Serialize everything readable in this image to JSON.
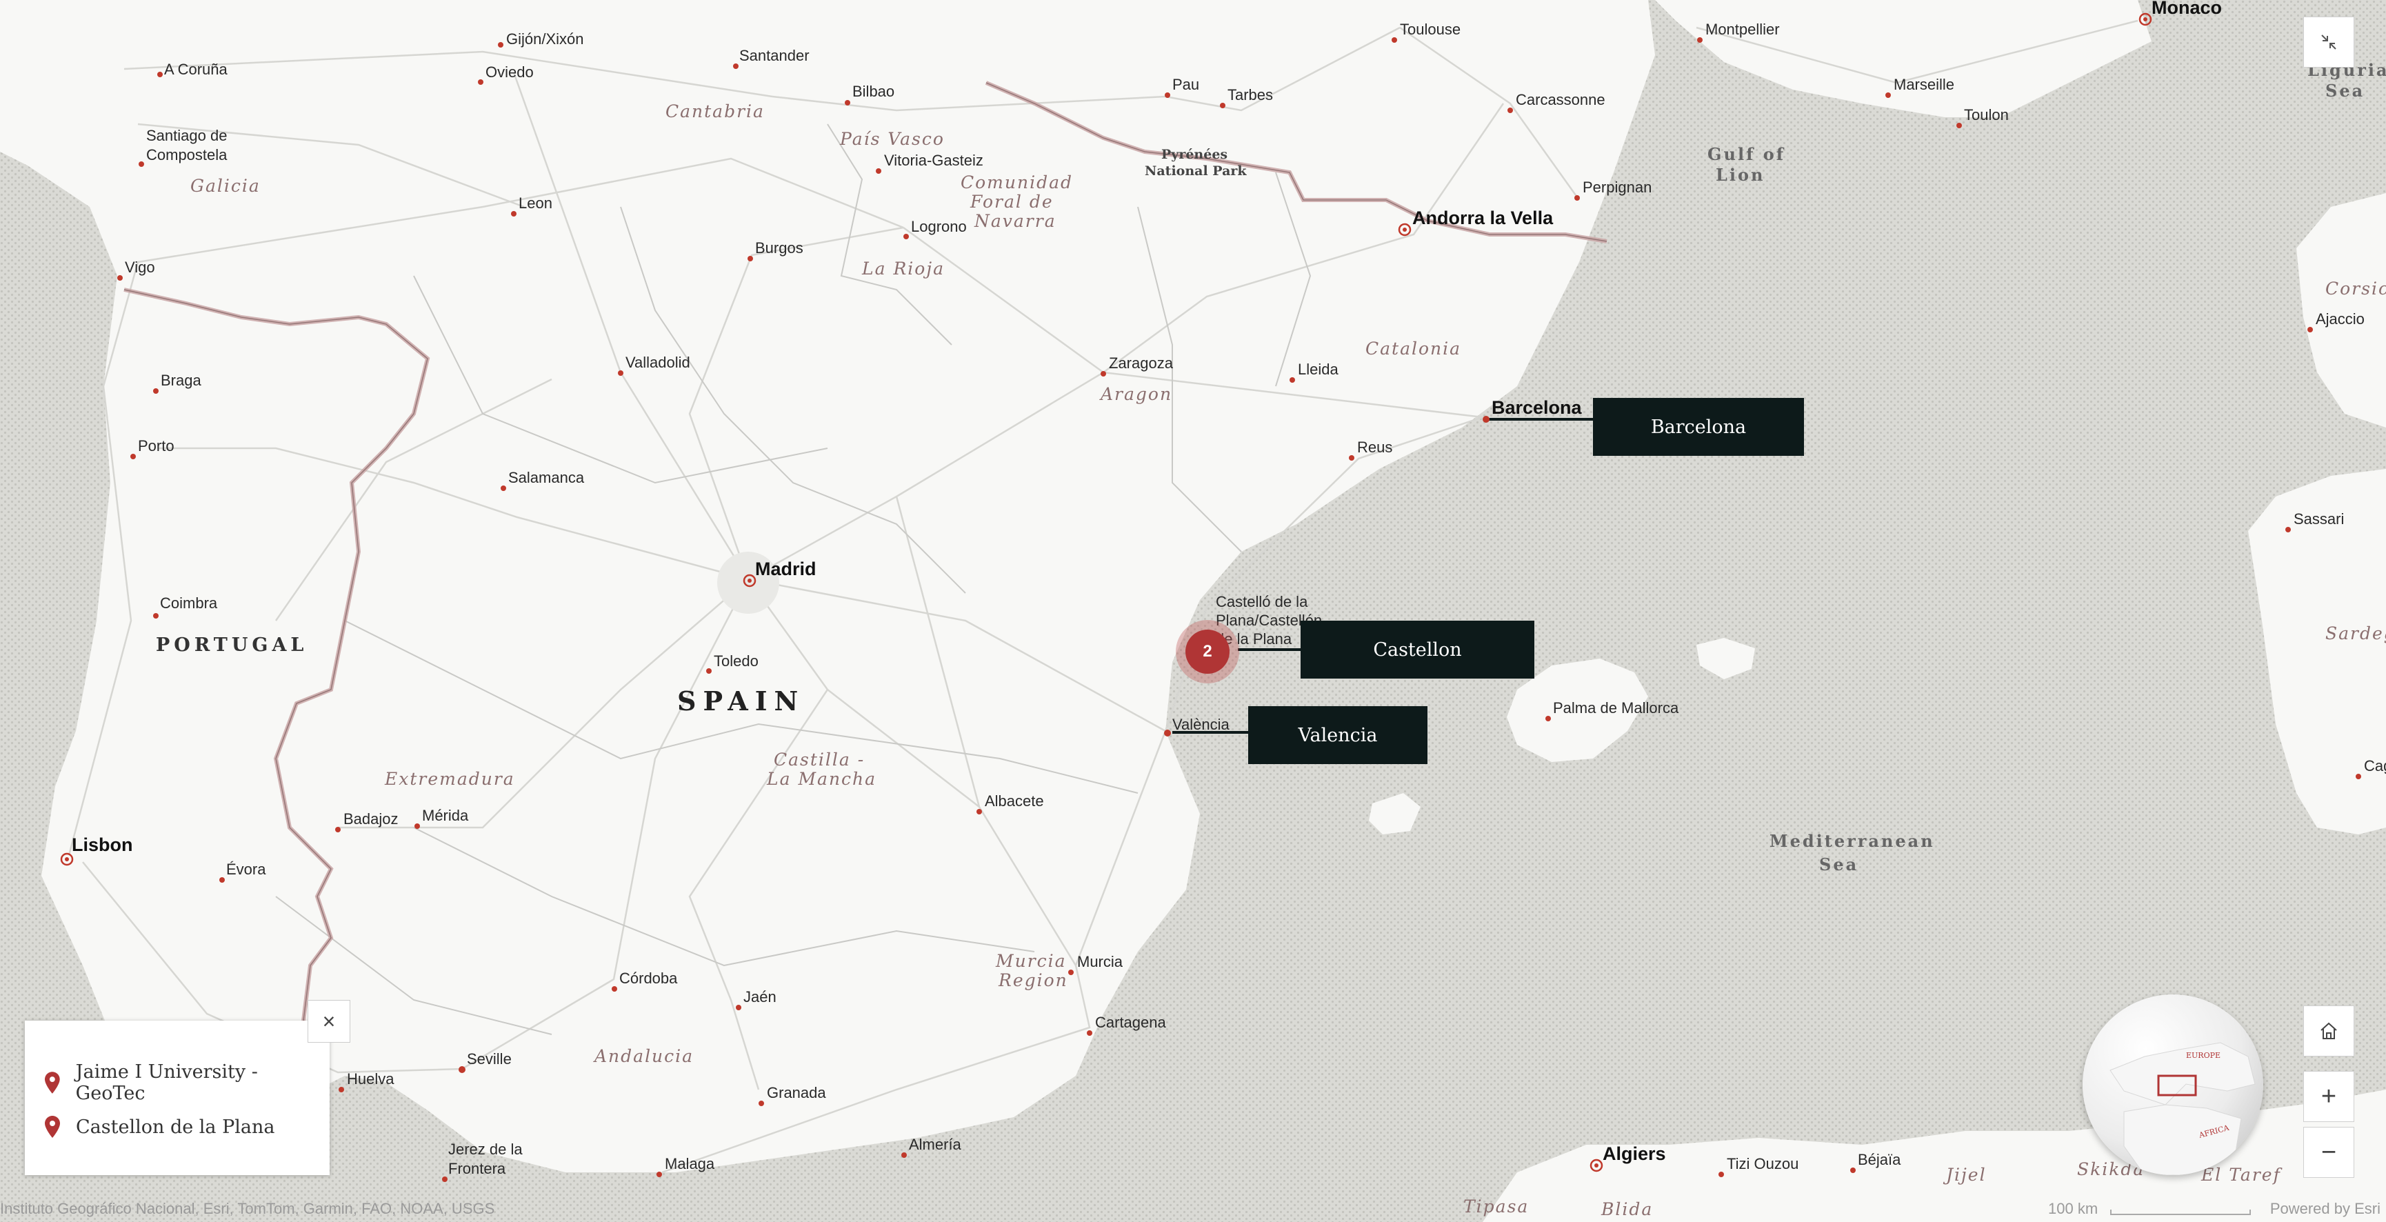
{
  "map": {
    "country_labels": {
      "spain": "SPAIN",
      "portugal": "PORTUGAL"
    },
    "cities": [
      "A Coruña",
      "Gijón/Xixón",
      "Santander",
      "Oviedo",
      "Bilbao",
      "Santiago de",
      "Compostela",
      "Vitoria-Gasteiz",
      "Leon",
      "Logrono",
      "Burgos",
      "Vigo",
      "Braga",
      "Valladolid",
      "Porto",
      "Salamanca",
      "Zaragoza",
      "Lleida",
      "Reus",
      "Barcelona",
      "Madrid",
      "Coimbra",
      "Toledo",
      "Castelló de la",
      "Plana/Castellón",
      "de la Plana",
      "València",
      "Albacete",
      "Lisbon",
      "Badajoz",
      "Mérida",
      "Évora",
      "Córdoba",
      "Jaén",
      "Murcia",
      "Cartagena",
      "Seville",
      "Huelva",
      "Granada",
      "Almería",
      "Jerez de la",
      "Frontera",
      "Malaga",
      "Toulouse",
      "Montpellier",
      "Monaco",
      "Pau",
      "Tarbes",
      "Carcassonne",
      "Marseille",
      "Toulon",
      "Perpignan",
      "Andorra la Vella",
      "Ajaccio",
      "Sassari",
      "Palma de Mallorca",
      "Algiers",
      "Tizi Ouzou",
      "Béjaïa",
      "Cagl"
    ],
    "regions": [
      "Cantabria",
      "País Vasco",
      "Comunidad",
      "Foral de",
      "Navarra",
      "Galicia",
      "La Rioja",
      "Catalonia",
      "Aragon",
      "Castilla -",
      "La Mancha",
      "Extremadura",
      "Murcia",
      "Region",
      "Andalucia",
      "Corsica",
      "Sardegna",
      "Jijel",
      "El Taref",
      "Skikda",
      "Tipasa",
      "Blida"
    ],
    "seas": [
      "Gulf of",
      "Lion",
      "Mediterranean",
      "Sea",
      "Ligurian",
      "Sea"
    ],
    "park": [
      "Pyrénées",
      "National Park"
    ]
  },
  "callouts": {
    "barcelona": "Barcelona",
    "castellon": "Castellon",
    "valencia": "Valencia"
  },
  "cluster": {
    "count": "2"
  },
  "legend": {
    "items": [
      "Jaime I University - GeoTec",
      "Castellon de la Plana"
    ],
    "close_icon": "×"
  },
  "controls": {
    "zoom_in": "+",
    "zoom_out": "−"
  },
  "footer": {
    "attribution": "Instituto Geográfico Nacional, Esri, TomTom, Garmin, FAO, NOAA, USGS",
    "scale": "100 km",
    "powered": "Powered by Esri"
  },
  "globe": {
    "labels": [
      "EUROPE",
      "AFRICA"
    ]
  },
  "colors": {
    "land": "#f8f8f6",
    "sea": "#d9d9d4",
    "border": "#b88e8e",
    "callout_bg": "#0d1a1a",
    "city_dot": "#c0392b",
    "cluster": "#b03535"
  }
}
